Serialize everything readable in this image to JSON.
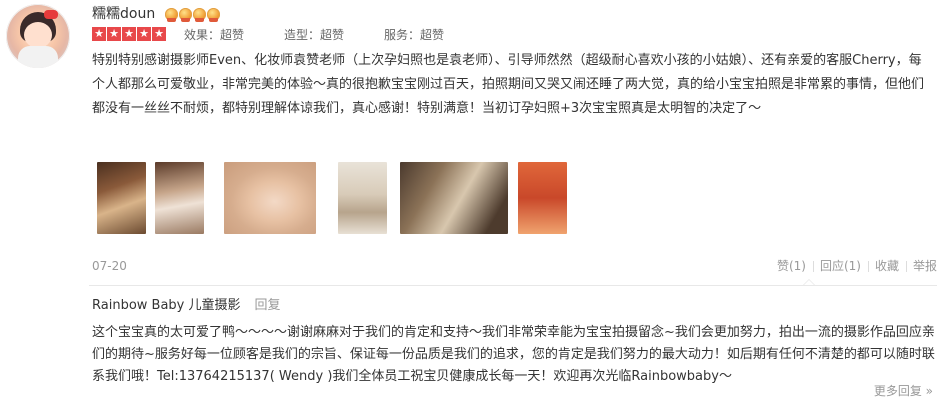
{
  "review": {
    "username": "糯糯doun",
    "badges": [
      "medal-icon",
      "medal-icon",
      "medal-icon",
      "medal-icon"
    ],
    "stars": [
      "star-icon",
      "star-icon",
      "star-icon",
      "star-icon",
      "star-icon"
    ],
    "rating_value": 5,
    "scores": {
      "effect": "效果：超赞",
      "styling": "造型：超赞",
      "service": "服务：超赞"
    },
    "text": "特别特别感谢摄影师Even、化妆师袁赞老师（上次孕妇照也是袁老师）、引导师然然（超级耐心喜欢小孩的小姑娘）、还有亲爱的客服Cherry，每个人都那么可爱敬业，非常完美的体验～真的很抱歉宝宝刚过百天，拍照期间又哭又闹还睡了两大觉，真的给小宝宝拍照是非常累的事情，但他们都没有一丝丝不耐烦，都特别理解体谅我们，真心感谢！特别满意！当初订孕妇照+3次宝宝照真是太明智的决定了～",
    "photos": [
      "photo-1",
      "photo-2",
      "photo-3",
      "photo-4",
      "photo-5",
      "photo-6"
    ],
    "date": "07-20",
    "actions": {
      "like": "赞(1)",
      "reply": "回应(1)",
      "favorite": "收藏",
      "report": "举报"
    }
  },
  "reply": {
    "shop_name": "Rainbow Baby 儿童摄影",
    "reply_button": "回复",
    "text": "这个宝宝真的太可爱了鸭～～～～谢谢麻麻对于我们的肯定和支持～我们非常荣幸能为宝宝拍摄留念~我们会更加努力，拍出一流的摄影作品回应亲们的期待~服务好每一位顾客是我们的宗旨、保证每一份品质是我们的追求，您的肯定是我们努力的最大动力！如后期有任何不清楚的都可以随时联系我们哦！Tel:13764215137( Wendy )我们全体员工祝宝贝健康成长每一天！欢迎再次光临Rainbowbaby～",
    "more": "更多回复 »"
  },
  "colors": {
    "star": "#e8484a",
    "meta": "#999999",
    "text": "#333333",
    "divider": "#e8e8e8"
  }
}
